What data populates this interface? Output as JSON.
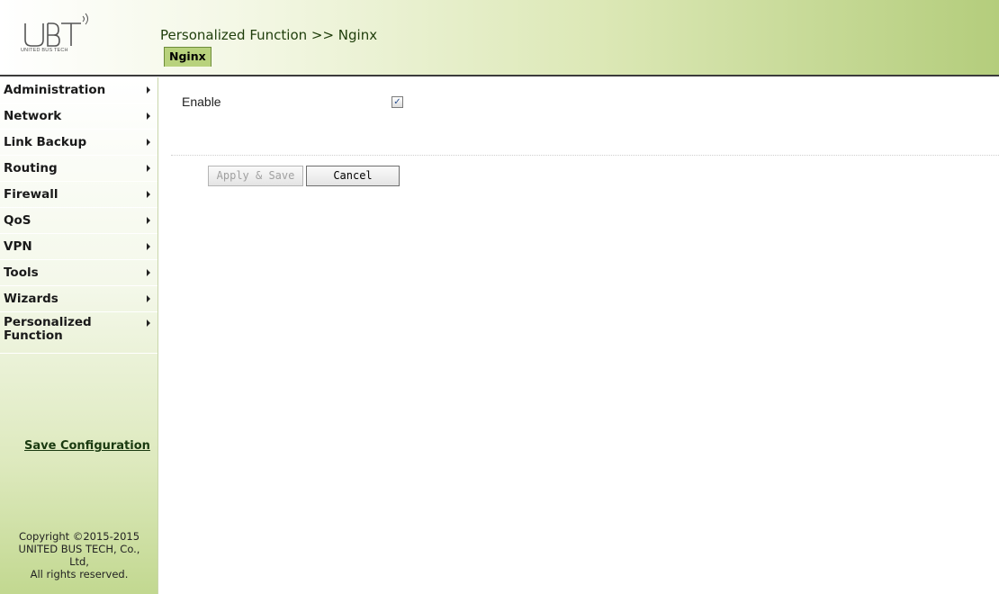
{
  "header": {
    "logo_subtitle": "UNITED BUS TECH",
    "breadcrumb": "Personalized Function >> Nginx",
    "tab_label": "Nginx"
  },
  "sidebar": {
    "items": [
      {
        "label": "Administration"
      },
      {
        "label": "Network"
      },
      {
        "label": "Link Backup"
      },
      {
        "label": "Routing"
      },
      {
        "label": "Firewall"
      },
      {
        "label": "QoS"
      },
      {
        "label": "VPN"
      },
      {
        "label": "Tools"
      },
      {
        "label": "Wizards"
      },
      {
        "label": "Personalized\nFunction"
      }
    ],
    "save_config": "Save Configuration",
    "copyright": {
      "line1": "Copyright ©2015-2015",
      "line2": "UNITED BUS TECH, Co.,",
      "line3": "Ltd,",
      "line4": "All rights reserved."
    }
  },
  "form": {
    "enable_label": "Enable",
    "enable_checked": true,
    "checkmark": "✓",
    "apply_label": "Apply & Save",
    "cancel_label": "Cancel"
  },
  "colors": {
    "header_accent": "#b4cd7c",
    "tab_bg": "#b8d27d",
    "sidebar_bottom": "#c2d890",
    "breadcrumb_text": "#1e3d0a"
  }
}
